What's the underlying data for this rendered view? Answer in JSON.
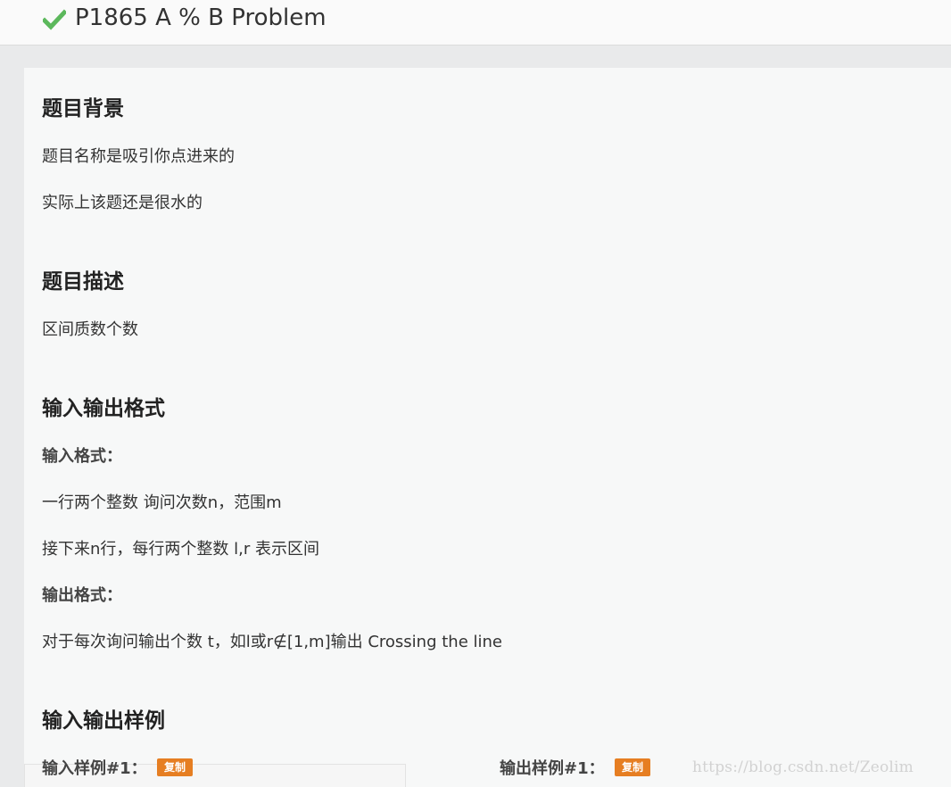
{
  "header": {
    "status_icon": "check-icon",
    "status_color": "#5cb85c",
    "title": "P1865 A % B Problem"
  },
  "background": {
    "heading": "题目背景",
    "lines": [
      "题目名称是吸引你点进来的",
      "实际上该题还是很水的"
    ]
  },
  "description": {
    "heading": "题目描述",
    "lines": [
      "区间质数个数"
    ]
  },
  "io_format": {
    "heading": "输入输出格式",
    "input_label": "输入格式：",
    "input_lines": [
      "一行两个整数 询问次数n，范围m",
      "接下来n行，每行两个整数 l,r 表示区间"
    ],
    "output_label": "输出格式：",
    "output_lines": [
      "对于每次询问输出个数 t，如l或r∉[1,m]输出 Crossing the line"
    ]
  },
  "samples": {
    "heading": "输入输出样例",
    "input_label": "输入样例#1：",
    "output_label": "输出样例#1：",
    "copy_label": "复制",
    "copy_color": "#e67e22"
  },
  "watermark": "https://blog.csdn.net/Zeolim"
}
